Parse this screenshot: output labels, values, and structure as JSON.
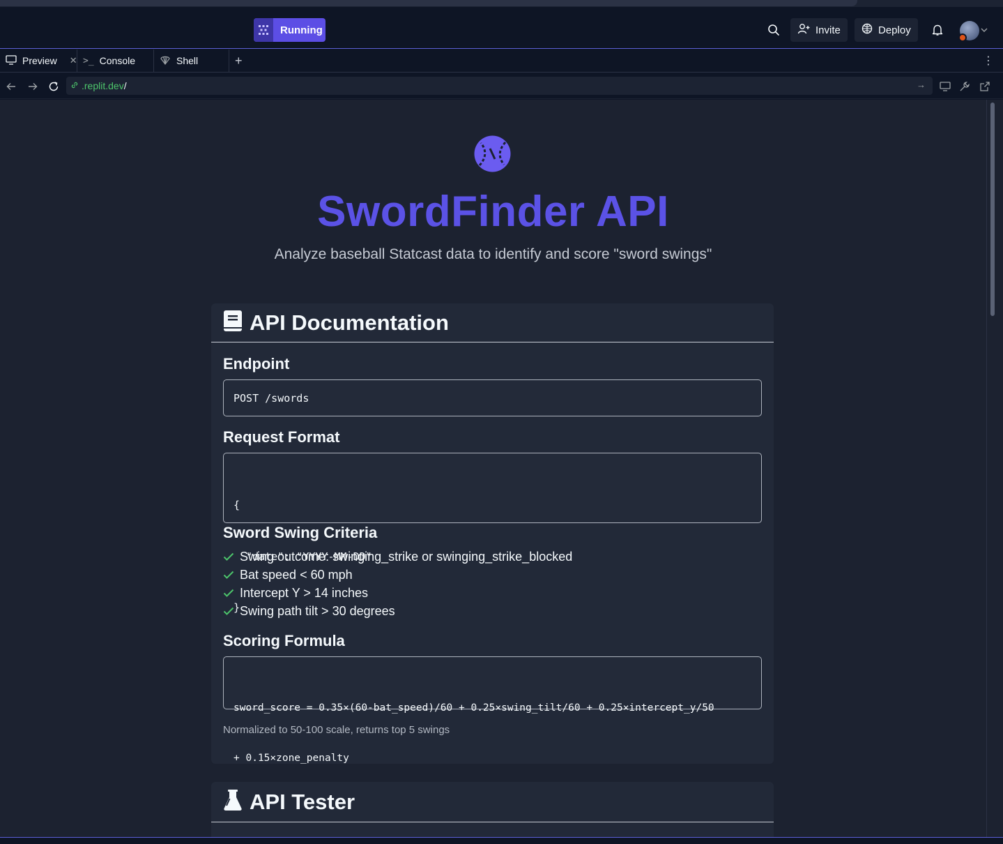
{
  "topbar": {
    "run_label": "Running",
    "invite_label": "Invite",
    "deploy_label": "Deploy"
  },
  "tabs": [
    {
      "label": "Preview",
      "icon": "monitor-icon"
    },
    {
      "label": "Console",
      "icon": "terminal-icon"
    },
    {
      "label": "Shell",
      "icon": "shell-icon"
    }
  ],
  "url": {
    "host": ".replit.dev",
    "path": "/"
  },
  "page": {
    "title": "SwordFinder API",
    "subtitle": "Analyze baseball Statcast data to identify and score \"sword swings\"",
    "docs": {
      "heading": "API Documentation",
      "endpoint_heading": "Endpoint",
      "endpoint_code": "POST /swords",
      "request_heading": "Request Format",
      "request_lines": [
        "{",
        "  \"date\": \"YYYY-MM-DD\"",
        "}"
      ],
      "criteria_heading": "Sword Swing Criteria",
      "criteria": [
        "Swing outcome: swinging_strike or swinging_strike_blocked",
        "Bat speed < 60 mph",
        "Intercept Y > 14 inches",
        "Swing path tilt > 30 degrees"
      ],
      "formula_heading": "Scoring Formula",
      "formula_lines": [
        "sword_score = 0.35×(60-bat_speed)/60 + 0.25×swing_tilt/60 + 0.25×intercept_y/50",
        "+ 0.15×zone_penalty"
      ],
      "note": "Normalized to 50-100 scale, returns top 5 swings"
    },
    "tester": {
      "heading": "API Tester"
    }
  },
  "colors": {
    "accent": "#5b52e6",
    "run_button": "#5c4ee5",
    "check": "#4dc56b",
    "url_host": "#4dc56b"
  }
}
